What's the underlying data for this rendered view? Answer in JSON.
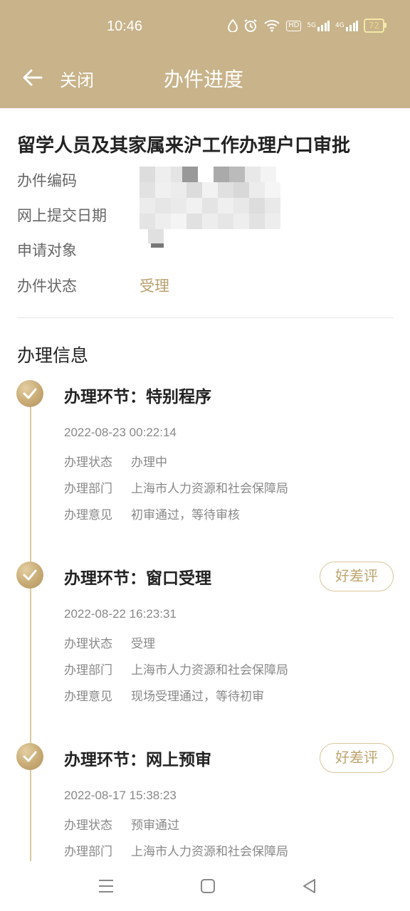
{
  "status_bar": {
    "time": "10:46",
    "icons": [
      "drop-icon",
      "alarm-icon",
      "wifi-icon",
      "hd-icon",
      "5g-signal-icon",
      "4g-signal-icon",
      "battery-icon"
    ],
    "hd_label": "HD",
    "signal_5g_label": "5G",
    "signal_4g_label": "4G",
    "battery_level": "72"
  },
  "nav": {
    "back_icon": "arrow-left-icon",
    "close_label": "关闭",
    "title": "办件进度"
  },
  "case": {
    "title": "留学人员及其家属来沪工作办理户口审批",
    "rows": [
      {
        "label": "办件编码",
        "value": ""
      },
      {
        "label": "网上提交日期",
        "value": ""
      },
      {
        "label": "申请对象",
        "value": ""
      },
      {
        "label": "办件状态",
        "value": "受理"
      }
    ]
  },
  "section": {
    "title": "办理信息"
  },
  "steps": [
    {
      "title": "办理环节：特别程序",
      "time": "2022-08-23 00:22:14",
      "rows": [
        {
          "label": "办理状态",
          "value": "办理中"
        },
        {
          "label": "办理部门",
          "value": "上海市人力资源和社会保障局"
        },
        {
          "label": "办理意见",
          "value": "初审通过，等待审核"
        }
      ],
      "rate_label": ""
    },
    {
      "title": "办理环节：窗口受理",
      "time": "2022-08-22 16:23:31",
      "rows": [
        {
          "label": "办理状态",
          "value": "受理"
        },
        {
          "label": "办理部门",
          "value": "上海市人力资源和社会保障局"
        },
        {
          "label": "办理意见",
          "value": "现场受理通过，等待初审"
        }
      ],
      "rate_label": "好差评"
    },
    {
      "title": "办理环节：网上预审",
      "time": "2022-08-17 15:38:23",
      "rows": [
        {
          "label": "办理状态",
          "value": "预审通过"
        },
        {
          "label": "办理部门",
          "value": "上海市人力资源和社会保障局"
        }
      ],
      "rate_label": "好差评"
    }
  ],
  "system_nav": {
    "icons": [
      "menu-icon",
      "home-square-icon",
      "back-triangle-icon"
    ]
  },
  "colors": {
    "header": "#c8b38a",
    "accent": "#b9a06e",
    "timeline": "#d9c99f"
  }
}
